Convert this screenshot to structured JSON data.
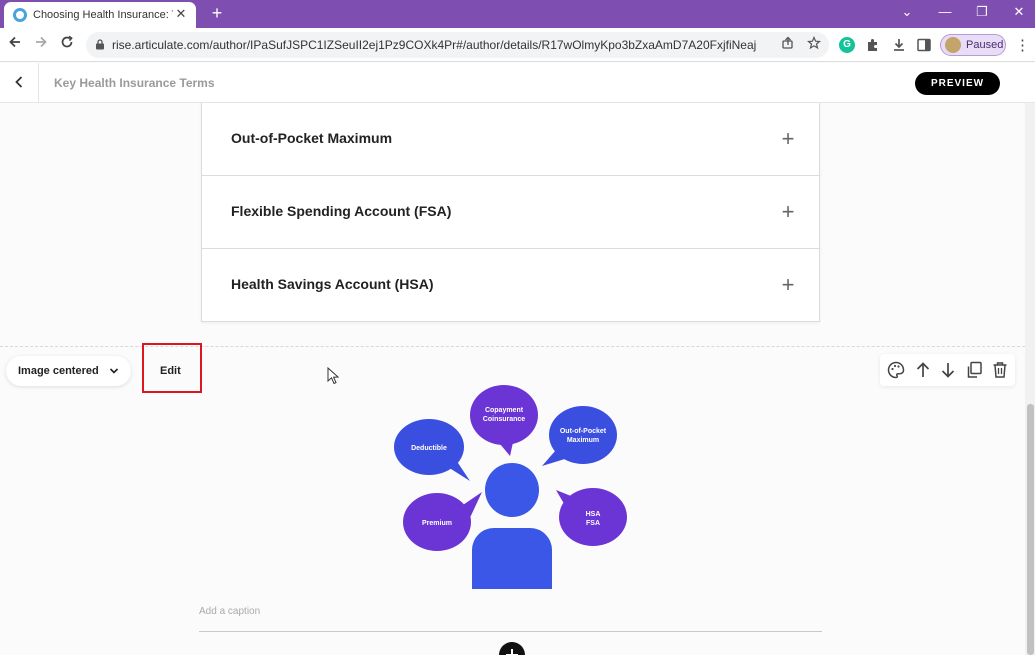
{
  "browser": {
    "tab_title": "Choosing Health Insurance: Trad",
    "tab_close": "✕",
    "new_tab": "+",
    "url": "rise.articulate.com/author/IPaSufJSPC1IZSeuII2ej1Pz9COXk4Pr#/author/details/R17wOlmyKpo3bZxaAmD7A20FxjfiNeaj",
    "profile_status": "Paused",
    "window_controls": {
      "collapse": "⌄",
      "minimize": "—",
      "restore": "❐",
      "close": "✕"
    }
  },
  "header": {
    "lesson_title": "Key Health Insurance Terms",
    "preview_label": "PREVIEW"
  },
  "accordion": {
    "items": [
      {
        "label": "Out-of-Pocket Maximum"
      },
      {
        "label": "Flexible Spending Account (FSA)"
      },
      {
        "label": "Health Savings Account (HSA)"
      }
    ]
  },
  "image_block": {
    "alignment_label": "Image centered",
    "edit_label": "Edit",
    "caption_placeholder": "Add a caption",
    "bubbles": {
      "copayment": "Copayment",
      "coinsurance": "Coinsurance",
      "deductible": "Deductible",
      "oop_line1": "Out-of-Pocket",
      "oop_line2": "Maximum",
      "premium": "Premium",
      "hsa": "HSA",
      "fsa": "FSA"
    }
  },
  "colors": {
    "browser_frame": "#7e4fb1",
    "bubble_purple": "#6b35d6",
    "bubble_blue": "#3a4fe0",
    "person_blue": "#3a57e8",
    "highlight_red": "#e0141e"
  }
}
